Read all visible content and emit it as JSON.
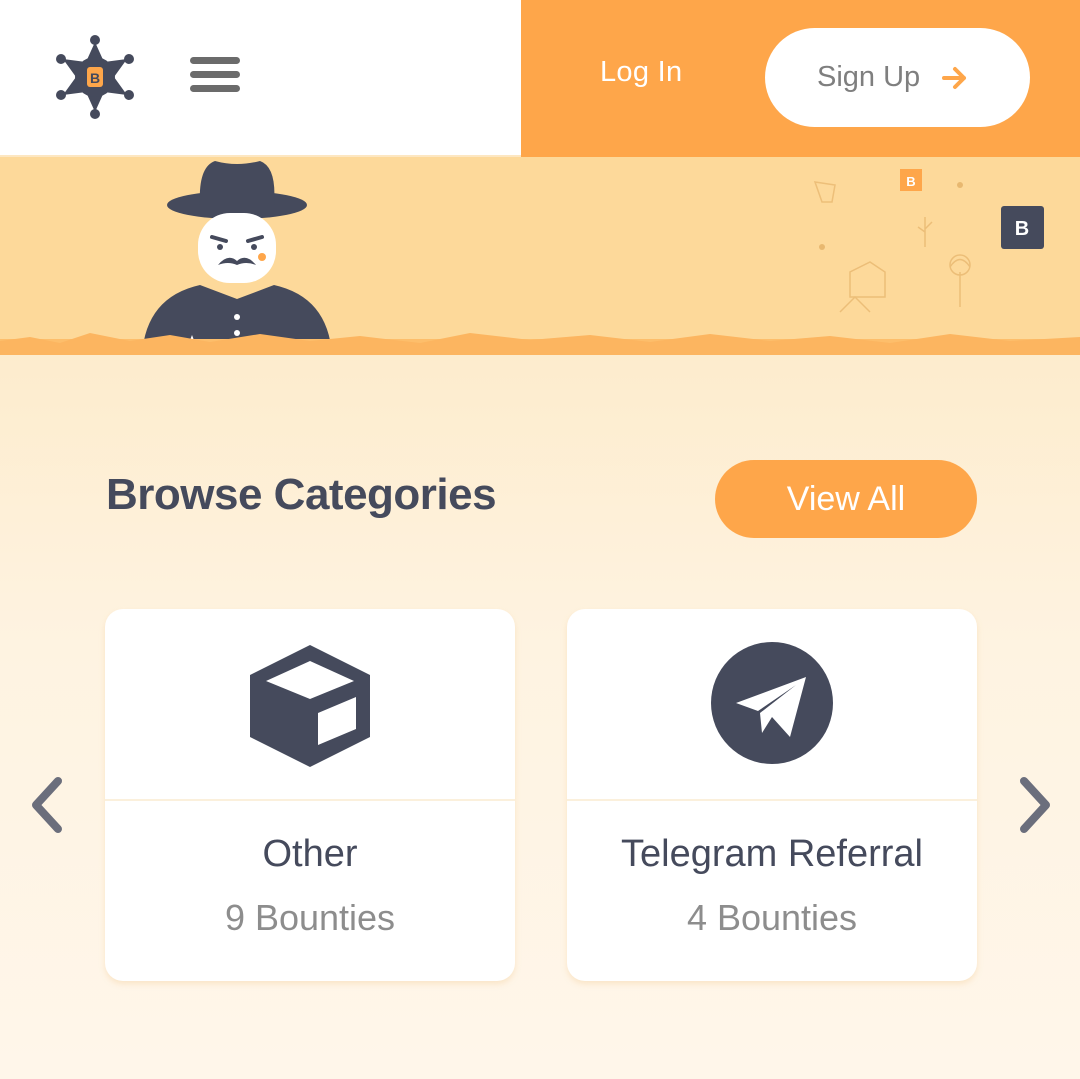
{
  "header": {
    "login_label": "Log In",
    "signup_label": "Sign Up",
    "logo_icon": "sheriff-badge-icon",
    "menu_icon": "hamburger-menu-icon"
  },
  "colors": {
    "accent": "#fea64a",
    "dark": "#454a5c",
    "banner": "#fdd99a"
  },
  "browse": {
    "title": "Browse Categories",
    "view_all_label": "View All"
  },
  "categories": [
    {
      "name": "Other",
      "count": "9 Bounties",
      "icon": "box-icon"
    },
    {
      "name": "Telegram Referral",
      "count": "4 Bounties",
      "icon": "telegram-icon"
    }
  ],
  "carousel": {
    "prev_icon": "chevron-left-icon",
    "next_icon": "chevron-right-icon"
  }
}
